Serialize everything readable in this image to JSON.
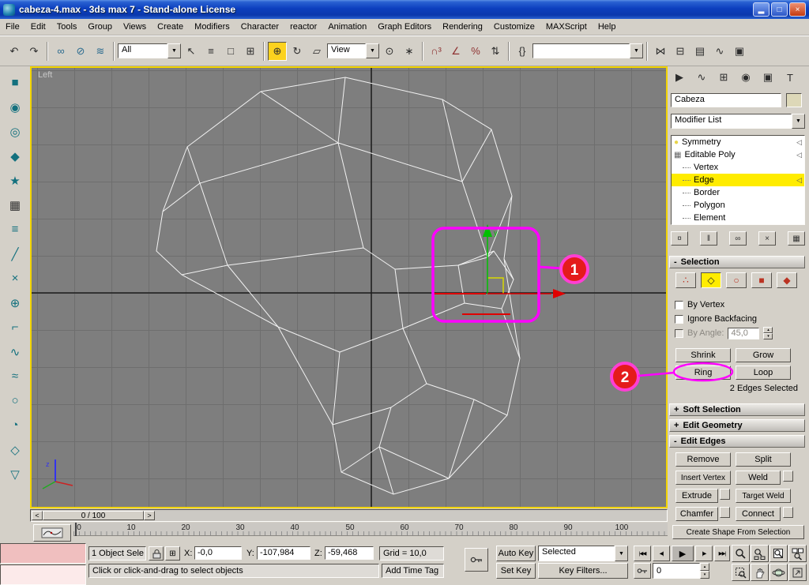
{
  "window": {
    "title": "cabeza-4.max - 3ds max 7 - Stand-alone License",
    "minimize": "▂",
    "restore": "□",
    "close": "×"
  },
  "menu": {
    "items": [
      "File",
      "Edit",
      "Tools",
      "Group",
      "Views",
      "Create",
      "Modifiers",
      "Character",
      "reactor",
      "Animation",
      "Graph Editors",
      "Rendering",
      "Customize",
      "MAXScript",
      "Help"
    ]
  },
  "toolbar": {
    "filter": "All",
    "view": "View",
    "named_sel": "",
    "dropdown": "▼",
    "icons": {
      "undo": "↶",
      "redo": "↷",
      "select_link": "∞",
      "unlink": "⊘",
      "bind_spacewarp": "≋",
      "select_object": "↖",
      "select_by_name": "≡",
      "rect_region": "□",
      "window_crossing": "⊞",
      "move": "⊕",
      "rotate": "↻",
      "scale": "▱",
      "use_center": "⊙",
      "manipulate": "∗",
      "snap": "∩³",
      "angle_snap": "∠",
      "percent_snap": "%",
      "spinner_snap": "⇅",
      "named_sets": "{}",
      "mirror": "⋈",
      "align": "⊟",
      "layers": "▤",
      "curve_editor": "∿",
      "schematic": "▣"
    }
  },
  "left_toolbar": {
    "icons": [
      "■",
      "◉",
      "◎",
      "◆",
      "★",
      "▦",
      "≡",
      "╱",
      "×",
      "⊕",
      "⌐",
      "∿",
      "≈",
      "○",
      "◔",
      "◇",
      "▽"
    ]
  },
  "viewport": {
    "label": "Left",
    "gizmo_y": "y",
    "axis_z": "z"
  },
  "annotations": {
    "one": "1",
    "two": "2"
  },
  "panel": {
    "tabs": {
      "create": "▶",
      "modify": "∿",
      "hierarchy": "⊞",
      "motion": "◉",
      "display": "▣",
      "utilities": "T"
    },
    "object_name": "Cabeza",
    "modifier_list": "Modifier List",
    "stack_icons": {
      "bulb": "●",
      "poly": "▦"
    },
    "stack_toggle": "◁",
    "stack": {
      "symmetry": "Symmetry",
      "editable_poly": "Editable Poly",
      "vertex": "Vertex",
      "edge": "Edge",
      "border": "Border",
      "polygon": "Polygon",
      "element": "Element"
    },
    "stack_tools": [
      "¤",
      "‖",
      "∞",
      "×",
      "▦"
    ],
    "subobj": [
      "∴",
      "◇",
      "○",
      "■",
      "◆"
    ],
    "selection": {
      "header": "Selection",
      "by_vertex": "By Vertex",
      "ignore_backfacing": "Ignore Backfacing",
      "by_angle": "By Angle:",
      "angle_value": "45,0",
      "shrink": "Shrink",
      "grow": "Grow",
      "ring": "Ring",
      "loop": "Loop",
      "status": "2 Edges Selected"
    },
    "rollouts": {
      "plus": "+",
      "minus": "-",
      "soft_selection": "Soft Selection",
      "edit_geometry": "Edit Geometry",
      "edit_edges": "Edit Edges"
    },
    "edit_edges": {
      "remove": "Remove",
      "split": "Split",
      "insert_vertex": "Insert Vertex",
      "weld": "Weld",
      "extrude": "Extrude",
      "target_weld": "Target Weld",
      "chamfer": "Chamfer",
      "connect": "Connect",
      "create_shape": "Create Shape From Selection"
    }
  },
  "timeline": {
    "slider": "0 / 100",
    "prev": "<",
    "next": ">",
    "ticks": [
      "0",
      "10",
      "20",
      "30",
      "40",
      "50",
      "60",
      "70",
      "80",
      "90",
      "100"
    ]
  },
  "status": {
    "selection": "1 Object Sele",
    "x": "X:",
    "x_val": "-0,0",
    "y": "Y:",
    "y_val": "-107,984",
    "z": "Z:",
    "z_val": "-59,468",
    "grid": "Grid = 10,0",
    "prompt": "Click or click-and-drag to select objects",
    "time_tag": "Add Time Tag"
  },
  "anim": {
    "auto_key": "Auto Key",
    "set_key": "Set Key",
    "selected": "Selected",
    "key_filters": "Key Filters...",
    "frame": "0",
    "go_start": "|◀◀",
    "prev_frame": "◀|",
    "play": "▶",
    "next_frame": "|▶",
    "go_end": "▶▶|"
  }
}
